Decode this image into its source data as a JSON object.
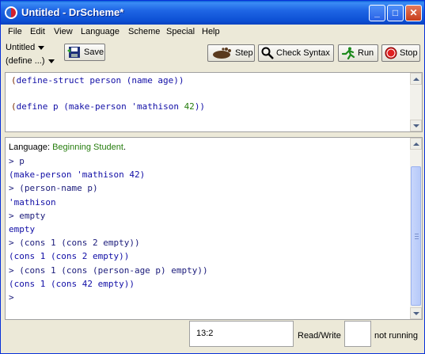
{
  "window": {
    "title": "Untitled - DrScheme*",
    "controls": {
      "minimize": "_",
      "maximize": "□",
      "close": "✕"
    }
  },
  "menu": [
    "File",
    "Edit",
    "View",
    "Language",
    "Scheme",
    "Special",
    "Help"
  ],
  "toolbar": {
    "file_dropdown": "Untitled",
    "define_dropdown": "(define ...)",
    "save_label": "Save",
    "step_label": "Step",
    "check_syntax_label": "Check Syntax",
    "run_label": "Run",
    "stop_label": "Stop"
  },
  "definitions": {
    "line1": {
      "open": "(",
      "kw": "define-struct",
      "rest": " person (name age))"
    },
    "line2": {
      "open": "(",
      "kw": "define",
      "rest": " p (make-person 'mathison ",
      "num": "42",
      "close": "))"
    }
  },
  "interactions": {
    "language_prefix": "Language: ",
    "language_name": "Beginning Student",
    "language_dot": ".",
    "lines": [
      {
        "kind": "input",
        "text": "> p"
      },
      {
        "kind": "output",
        "text": "(make-person 'mathison 42)"
      },
      {
        "kind": "input",
        "text": "> (person-name p)"
      },
      {
        "kind": "output",
        "text": "'mathison"
      },
      {
        "kind": "input",
        "text": "> empty"
      },
      {
        "kind": "output",
        "text": "empty"
      },
      {
        "kind": "input",
        "text": "> (cons 1 (cons 2 empty))"
      },
      {
        "kind": "output",
        "text": "(cons 1 (cons 2 empty))"
      },
      {
        "kind": "input",
        "text": "> (cons 1 (cons (person-age p) empty))"
      },
      {
        "kind": "output",
        "text": "(cons 1 (cons 42 empty))"
      },
      {
        "kind": "input",
        "text": ">"
      }
    ]
  },
  "status": {
    "position": "13:2",
    "mode": "Read/Write",
    "running": "not running"
  },
  "colors": {
    "titlebar": "#1f66e5",
    "keyword": "#267d0e",
    "output": "#110ea6",
    "stop": "#e02020"
  }
}
